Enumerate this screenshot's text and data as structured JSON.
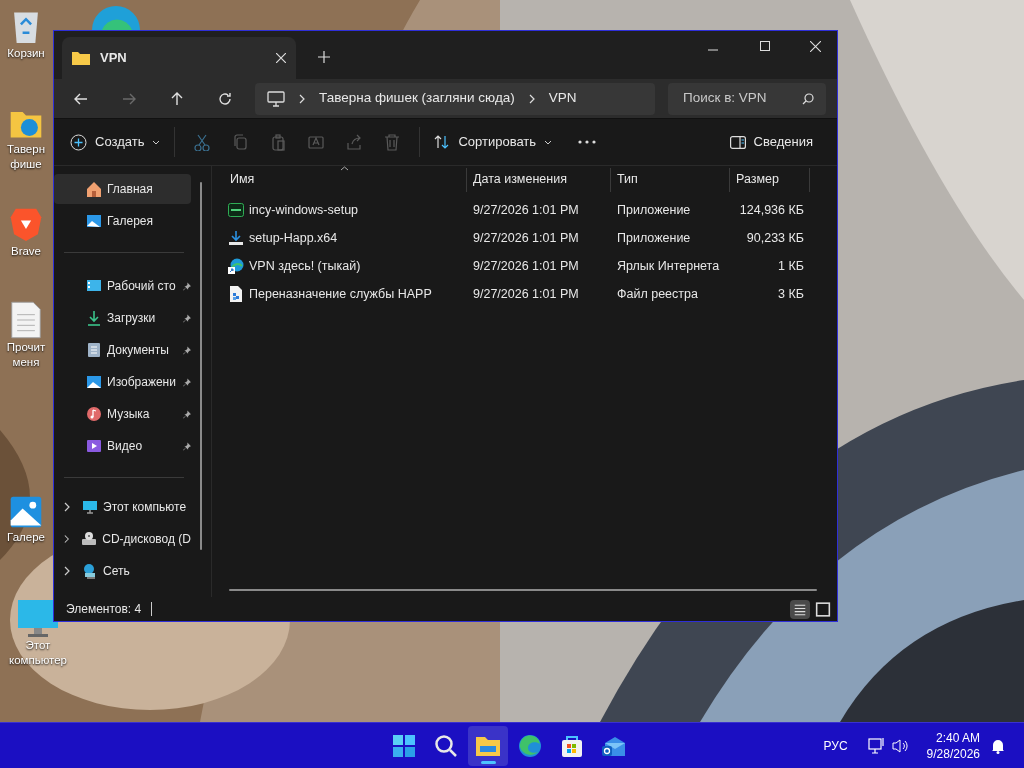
{
  "desktop": {
    "icons": [
      {
        "kind": "recycle",
        "lines": [
          "Корзин"
        ]
      },
      {
        "kind": "folder",
        "lines": [
          "Таверн",
          "фише"
        ]
      },
      {
        "kind": "brave",
        "lines": [
          "Brave"
        ]
      },
      {
        "kind": "document",
        "lines": [
          "Прочит",
          "меня"
        ]
      },
      {
        "kind": "gallery",
        "lines": [
          "Галере"
        ]
      },
      {
        "kind": "computer",
        "lines": [
          "Этот",
          "компьютер"
        ]
      }
    ]
  },
  "window": {
    "tabs": [
      {
        "title": "VPN",
        "selected": true
      }
    ],
    "nav": [
      {
        "kind": "back",
        "disabled": false
      },
      {
        "kind": "forward",
        "disabled": true
      },
      {
        "kind": "up",
        "disabled": false
      },
      {
        "kind": "refresh",
        "disabled": false
      }
    ],
    "breadcrumb": [
      "Таверна фишек (загляни сюда)",
      "VPN"
    ],
    "search": {
      "placeholder": "Поиск в: VPN"
    },
    "toolbar": {
      "create": "Создать",
      "tools": [
        {
          "kind": "cut",
          "disabled": true
        },
        {
          "kind": "copy",
          "disabled": true
        },
        {
          "kind": "paste",
          "disabled": true
        },
        {
          "kind": "rename",
          "disabled": true
        },
        {
          "kind": "share",
          "disabled": true
        },
        {
          "kind": "delete",
          "disabled": true
        }
      ],
      "sort": "Сортировать",
      "details": "Сведения"
    },
    "sidebar": {
      "groups": [
        [
          {
            "label": "Главная",
            "kind": "home",
            "selected": true,
            "pinned": false
          },
          {
            "label": "Галерея",
            "kind": "gallery",
            "selected": false,
            "pinned": false
          }
        ],
        [
          {
            "label": "Рабочий сто",
            "kind": "desktop",
            "selected": false,
            "pinned": true
          },
          {
            "label": "Загрузки",
            "kind": "downloads",
            "selected": false,
            "pinned": true
          },
          {
            "label": "Документы",
            "kind": "documents",
            "selected": false,
            "pinned": true
          },
          {
            "label": "Изображени",
            "kind": "pictures",
            "selected": false,
            "pinned": true
          },
          {
            "label": "Музыка",
            "kind": "music",
            "selected": false,
            "pinned": true
          },
          {
            "label": "Видео",
            "kind": "video",
            "selected": false,
            "pinned": true
          }
        ],
        [
          {
            "label": "Этот компьюте",
            "kind": "computer",
            "selected": false,
            "expanded": false
          },
          {
            "label": "CD-дисковод (D",
            "kind": "cd",
            "selected": false,
            "expanded": false
          },
          {
            "label": "Сеть",
            "kind": "network",
            "selected": false,
            "expanded": false
          }
        ]
      ]
    },
    "table": {
      "columns": [
        {
          "label": "Имя",
          "sorted": true
        },
        {
          "label": "Дата изменения",
          "sorted": false
        },
        {
          "label": "Тип",
          "sorted": false
        },
        {
          "label": "Размер",
          "sorted": false
        }
      ],
      "rows": [
        {
          "kind": "app",
          "name": "incy-windows-setup",
          "modified": "9/27/2026 1:01 PM",
          "type": "Приложение",
          "size": "124,936 КБ"
        },
        {
          "kind": "installer",
          "name": "setup-Happ.x64",
          "modified": "9/27/2026 1:01 PM",
          "type": "Приложение",
          "size": "90,233 КБ"
        },
        {
          "kind": "shortcut",
          "name": "VPN здесь! (тыкай)",
          "modified": "9/27/2026 1:01 PM",
          "type": "Ярлык Интернета",
          "size": "1 КБ"
        },
        {
          "kind": "registry",
          "name": "Переназначение службы HAPP",
          "modified": "9/27/2026 1:01 PM",
          "type": "Файл реестра",
          "size": "3 КБ"
        }
      ]
    },
    "status_bar": {
      "count": "Элементов: 4",
      "views": [
        {
          "kind": "details",
          "selected": true
        },
        {
          "kind": "tiles",
          "selected": false
        }
      ]
    }
  },
  "taskbar": {
    "apps": [
      {
        "kind": "start",
        "selected": false
      },
      {
        "kind": "search",
        "selected": false
      },
      {
        "kind": "explorer",
        "selected": true
      },
      {
        "kind": "edge",
        "selected": false
      },
      {
        "kind": "store",
        "selected": false
      },
      {
        "kind": "outlook",
        "selected": false
      }
    ],
    "language": "РУС",
    "time": "2:40 AM",
    "date": "9/28/2026"
  }
}
